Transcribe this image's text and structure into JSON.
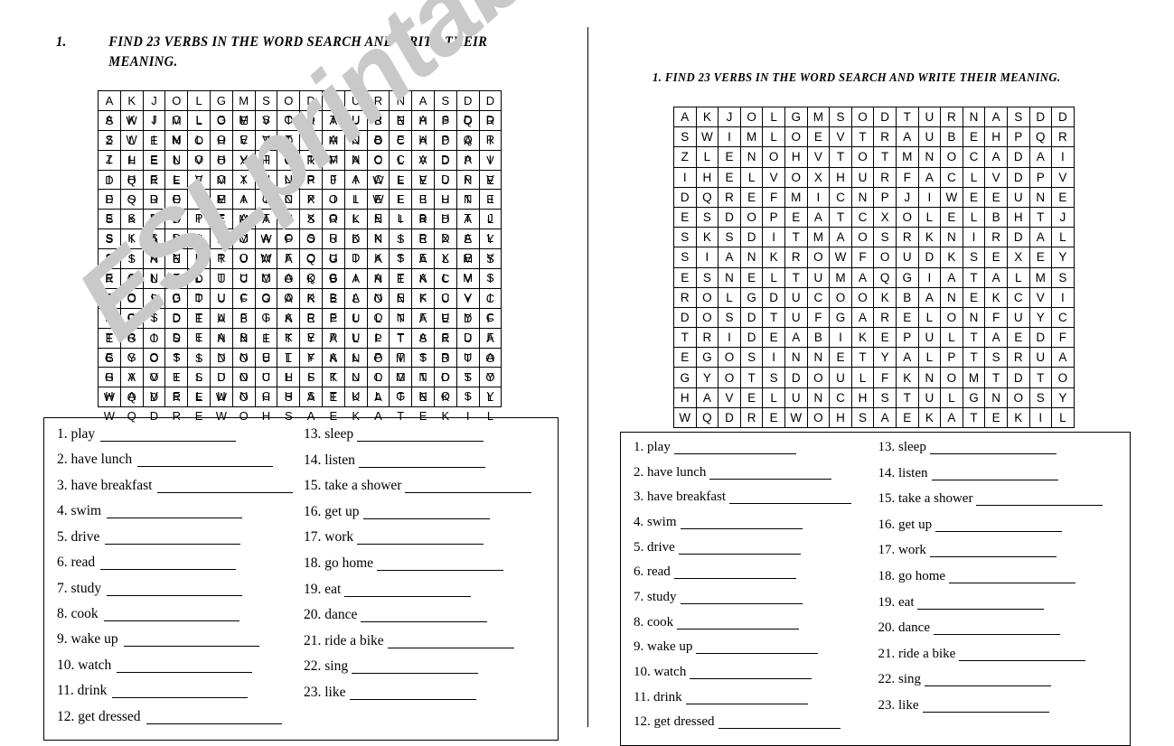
{
  "document": {
    "title_number": "1.",
    "instruction": "FIND 23 VERBS IN THE WORD SEARCH AND WRITE THEIR MEANING.",
    "instruction_line1": "FIND 23 VERBS IN THE WORD SEARCH AND WRITE THEIR",
    "instruction_line2": "MEANING.",
    "instruction_full": "1. FIND 23 VERBS IN THE WORD SEARCH AND WRITE THEIR MEANING.",
    "watermark": "ESLprintables.com",
    "watermark_color": "#c9c9c9",
    "ink_color": "#000000",
    "paper_color": "#ffffff"
  },
  "wordsearch": {
    "columns": 18,
    "rows": 16,
    "grid": [
      [
        "A",
        "K",
        "J",
        "O",
        "L",
        "G",
        "M",
        "S",
        "O",
        "D",
        "T",
        "U",
        "R",
        "N",
        "A",
        "S",
        "D",
        "D"
      ],
      [
        "S",
        "W",
        "I",
        "M",
        "L",
        "O",
        "E",
        "V",
        "T",
        "R",
        "A",
        "U",
        "B",
        "E",
        "H",
        "P",
        "Q",
        "R"
      ],
      [
        "Z",
        "L",
        "E",
        "N",
        "O",
        "H",
        "V",
        "T",
        "O",
        "T",
        "M",
        "N",
        "O",
        "C",
        "A",
        "D",
        "A",
        "I"
      ],
      [
        "I",
        "H",
        "E",
        "L",
        "V",
        "O",
        "X",
        "H",
        "U",
        "R",
        "F",
        "A",
        "C",
        "L",
        "V",
        "D",
        "P",
        "V"
      ],
      [
        "D",
        "Q",
        "R",
        "E",
        "F",
        "M",
        "I",
        "C",
        "N",
        "P",
        "J",
        "I",
        "W",
        "E",
        "E",
        "U",
        "N",
        "E"
      ],
      [
        "E",
        "S",
        "D",
        "O",
        "P",
        "E",
        "A",
        "T",
        "C",
        "X",
        "O",
        "L",
        "E",
        "L",
        "B",
        "H",
        "T",
        "J"
      ],
      [
        "S",
        "K",
        "S",
        "D",
        "I",
        "T",
        "M",
        "A",
        "O",
        "S",
        "R",
        "K",
        "N",
        "I",
        "R",
        "D",
        "A",
        "L"
      ],
      [
        "S",
        "I",
        "A",
        "N",
        "K",
        "R",
        "O",
        "W",
        "F",
        "O",
        "U",
        "D",
        "K",
        "S",
        "E",
        "X",
        "E",
        "Y"
      ],
      [
        "E",
        "S",
        "N",
        "E",
        "L",
        "T",
        "U",
        "M",
        "A",
        "Q",
        "G",
        "I",
        "A",
        "T",
        "A",
        "L",
        "M",
        "S"
      ],
      [
        "R",
        "O",
        "L",
        "G",
        "D",
        "U",
        "C",
        "O",
        "O",
        "K",
        "B",
        "A",
        "N",
        "E",
        "K",
        "C",
        "V",
        "I"
      ],
      [
        "D",
        "O",
        "S",
        "D",
        "T",
        "U",
        "F",
        "G",
        "A",
        "R",
        "E",
        "L",
        "O",
        "N",
        "F",
        "U",
        "Y",
        "C"
      ],
      [
        "T",
        "R",
        "I",
        "D",
        "E",
        "A",
        "B",
        "I",
        "K",
        "E",
        "P",
        "U",
        "L",
        "T",
        "A",
        "E",
        "D",
        "F"
      ],
      [
        "E",
        "G",
        "O",
        "S",
        "I",
        "N",
        "N",
        "E",
        "T",
        "Y",
        "A",
        "L",
        "P",
        "T",
        "S",
        "R",
        "U",
        "A"
      ],
      [
        "G",
        "Y",
        "O",
        "T",
        "S",
        "D",
        "O",
        "U",
        "L",
        "F",
        "K",
        "N",
        "O",
        "M",
        "T",
        "D",
        "T",
        "O"
      ],
      [
        "H",
        "A",
        "V",
        "E",
        "L",
        "U",
        "N",
        "C",
        "H",
        "S",
        "T",
        "U",
        "L",
        "G",
        "N",
        "O",
        "S",
        "Y"
      ],
      [
        "W",
        "Q",
        "D",
        "R",
        "E",
        "W",
        "O",
        "H",
        "S",
        "A",
        "E",
        "K",
        "A",
        "T",
        "E",
        "K",
        "I",
        "L"
      ]
    ]
  },
  "answer_list": {
    "column_a": [
      {
        "number": "1.",
        "verb": "play"
      },
      {
        "number": "2.",
        "verb": "have lunch"
      },
      {
        "number": "3.",
        "verb": "have breakfast"
      },
      {
        "number": "4.",
        "verb": "swim"
      },
      {
        "number": "5.",
        "verb": "drive"
      },
      {
        "number": "6.",
        "verb": "read"
      },
      {
        "number": "7.",
        "verb": "study"
      },
      {
        "number": "8.",
        "verb": "cook"
      },
      {
        "number": "9.",
        "verb": "wake up"
      },
      {
        "number": "10.",
        "verb": "watch"
      },
      {
        "number": "11.",
        "verb": "drink"
      },
      {
        "number": "12.",
        "verb": "get dressed"
      }
    ],
    "column_b": [
      {
        "number": "13.",
        "verb": "sleep"
      },
      {
        "number": "14.",
        "verb": "listen"
      },
      {
        "number": "15.",
        "verb": "take a shower"
      },
      {
        "number": "16.",
        "verb": "get up"
      },
      {
        "number": "17.",
        "verb": "work"
      },
      {
        "number": "18.",
        "verb": "go home"
      },
      {
        "number": "19.",
        "verb": "eat"
      },
      {
        "number": "20.",
        "verb": "dance"
      },
      {
        "number": "21.",
        "verb": "ride a bike"
      },
      {
        "number": "22.",
        "verb": "sing"
      },
      {
        "number": "23.",
        "verb": "like"
      }
    ]
  }
}
